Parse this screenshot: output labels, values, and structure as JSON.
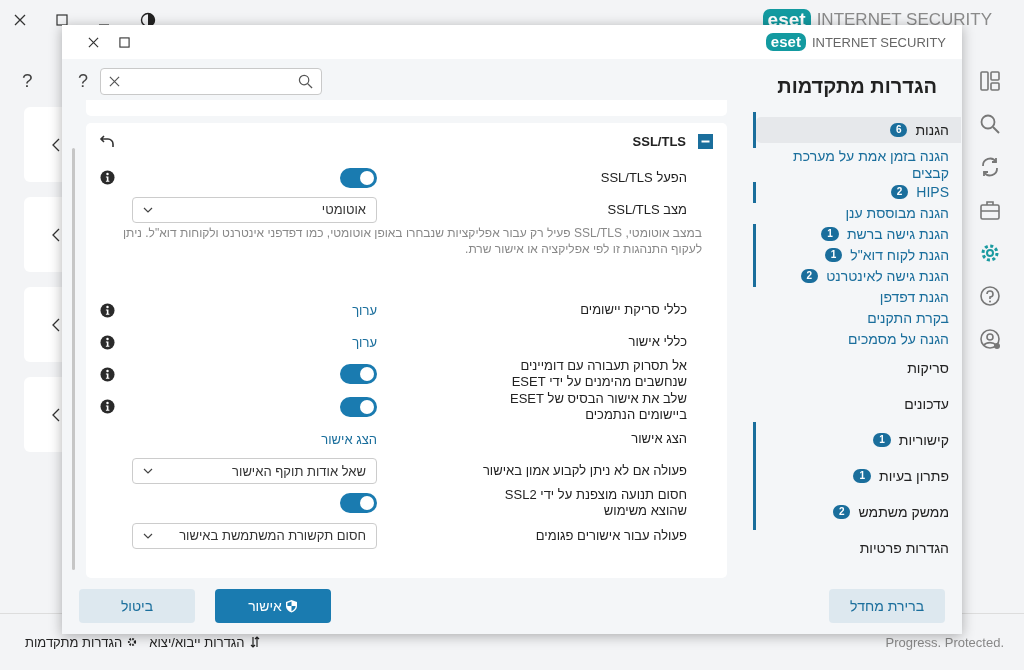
{
  "app": {
    "brand": {
      "logo": "eset",
      "product": "INTERNET SECURITY"
    },
    "help": "?",
    "nav_icons": [
      {
        "kind": "dashboard",
        "selected": false
      },
      {
        "kind": "search",
        "selected": false
      },
      {
        "kind": "update",
        "selected": false
      },
      {
        "kind": "tools",
        "selected": false
      },
      {
        "kind": "settings",
        "selected": true
      },
      {
        "kind": "help",
        "selected": false
      },
      {
        "kind": "account",
        "selected": false
      }
    ],
    "bottom_links": [
      {
        "kind": "transfer",
        "label": "הגדרות ייבוא/יצוא"
      },
      {
        "kind": "gear",
        "label": "הגדרות מתקדמות"
      }
    ],
    "status": "Progress. Protected."
  },
  "dialog": {
    "brand": {
      "logo": "eset",
      "product": "INTERNET SECURITY"
    },
    "title": "הגדרות מתקדמות",
    "help": "?",
    "nav": [
      {
        "label": "הגנות",
        "badge": "6",
        "selected": true,
        "modified": true,
        "children": [
          {
            "label": "הגנה בזמן אמת על מערכת קבצים",
            "modified": false
          },
          {
            "label": "HIPS",
            "badge": "2",
            "modified": true
          },
          {
            "label": "הגנה מבוססת ענן",
            "modified": false
          },
          {
            "label": "הגנת גישה ברשת",
            "badge": "1",
            "modified": true
          },
          {
            "label": "הגנת לקוח דוא\"ל",
            "badge": "1",
            "modified": true
          },
          {
            "label": "הגנת גישה לאינטרנט",
            "badge": "2",
            "modified": true
          },
          {
            "label": "הגנת דפדפן",
            "modified": false
          },
          {
            "label": "בקרת התקנים",
            "modified": false
          },
          {
            "label": "הגנה על מסמכים",
            "modified": false
          }
        ]
      },
      {
        "label": "סריקות",
        "selected": false,
        "modified": false
      },
      {
        "label": "עדכונים",
        "selected": false,
        "modified": false
      },
      {
        "label": "קישוריות",
        "badge": "1",
        "selected": false,
        "modified": true
      },
      {
        "label": "פתרון בעיות",
        "badge": "1",
        "selected": false,
        "modified": true
      },
      {
        "label": "ממשק משתמש",
        "badge": "2",
        "selected": false,
        "modified": true
      },
      {
        "label": "הגדרות פרטיות",
        "selected": false,
        "modified": false
      }
    ],
    "section": {
      "title": "SSL/TLS",
      "expanded": true,
      "rows": [
        {
          "kind": "toggle",
          "label": "הפעל SSL/TLS",
          "on": true,
          "info": true
        },
        {
          "kind": "select",
          "label": "מצב SSL/TLS",
          "value": "אוטומטי",
          "info": false
        },
        {
          "kind": "note",
          "text": "במצב אוטומטי, SSL/TLS פעיל רק עבור אפליקציות שנבחרו באופן אוטומטי, כמו דפדפני אינטרנט ולקוחות דוא\"ל. ניתן לעקוף התנהגות זו לפי אפליקציה או אישור שרת."
        },
        {
          "kind": "link",
          "label": "כללי סריקת יישומים",
          "link": "ערוך",
          "info": true
        },
        {
          "kind": "link",
          "label": "כללי אישור",
          "link": "ערוך",
          "info": true
        },
        {
          "kind": "toggle",
          "label": "אל תסרוק תעבורה עם דומיינים שנחשבים מהימנים על ידי ESET",
          "on": true,
          "info": true
        },
        {
          "kind": "toggle",
          "label": "שלב את אישור הבסיס של ESET ביישומים הנתמכים",
          "on": true,
          "info": true
        },
        {
          "kind": "link",
          "label": "הצג אישור",
          "link": "הצג אישור",
          "info": false
        },
        {
          "kind": "select",
          "label": "פעולה אם לא ניתן לקבוע אמון באישור",
          "value": "שאל אודות תוקף האישור",
          "info": false
        },
        {
          "kind": "toggle",
          "label": "חסום תנועה מוצפנת על ידי SSL2 שהוצא משימוש",
          "on": true,
          "info": false
        },
        {
          "kind": "select",
          "label": "פעולה עבור אישורים פגומים",
          "value": "חסום תקשורת המשתמשת באישור",
          "info": false
        }
      ]
    },
    "buttons": [
      {
        "kind": "secondary",
        "label": "ברירת מחדל"
      },
      {
        "kind": "primary",
        "label": "אישור"
      },
      {
        "kind": "secondary",
        "label": "ביטול"
      }
    ]
  }
}
